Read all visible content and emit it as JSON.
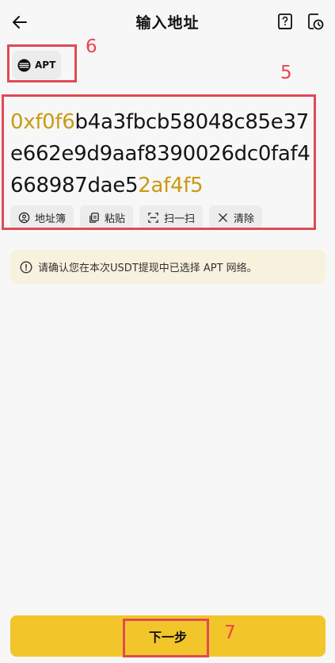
{
  "header": {
    "title": "输入地址",
    "back_icon": "arrow-left-icon",
    "help_icon": "help-book-icon",
    "history_icon": "history-clock-icon"
  },
  "network": {
    "label": "APT",
    "icon": "aptos-logo-icon"
  },
  "address": {
    "prefix": "0xf0f6",
    "middle": "b4a3fbcb58048c85e37e662e9d9aaf8390026dc0faf4668987dae5",
    "suffix": "2af4f5",
    "highlight_color": "#c99a12"
  },
  "tools": [
    {
      "label": "地址簿",
      "icon": "address-book-icon"
    },
    {
      "label": "粘贴",
      "icon": "paste-icon"
    },
    {
      "label": "扫一扫",
      "icon": "scan-icon"
    },
    {
      "label": "清除",
      "icon": "close-icon"
    }
  ],
  "notice": {
    "text": "请确认您在本次USDT提现中已选择 APT 网络。",
    "icon": "info-icon"
  },
  "next_button": {
    "label": "下一步"
  },
  "annotations": {
    "address_area": "5",
    "network_chip": "6",
    "next_button": "7"
  },
  "colors": {
    "accent": "#f2c62a",
    "annotation": "#e04a55",
    "notice_bg": "#f8f1de"
  }
}
